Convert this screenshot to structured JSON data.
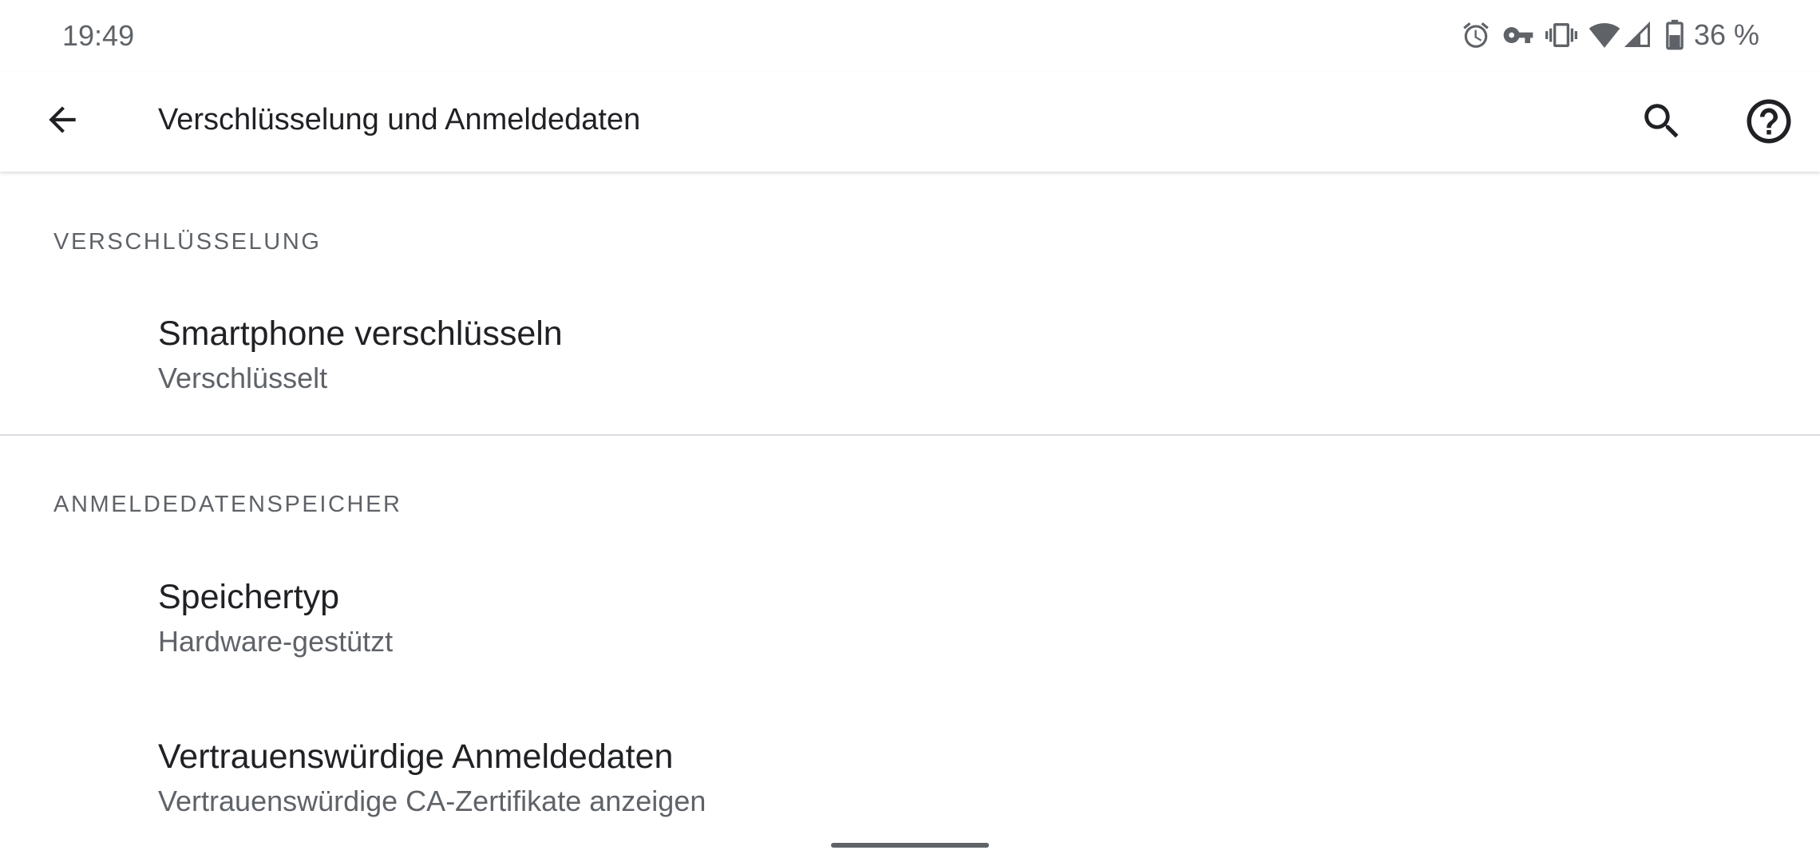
{
  "status_bar": {
    "time": "19:49",
    "icons": [
      "alarm-icon",
      "vpn-key-icon",
      "vibrate-icon",
      "wifi-icon",
      "signal-icon",
      "battery-icon"
    ],
    "battery_percent": "36 %"
  },
  "app_bar": {
    "title": "Verschlüsselung und Anmeldedaten",
    "back_icon": "arrow-back-icon",
    "search_icon": "search-icon",
    "help_icon": "help-icon"
  },
  "sections": [
    {
      "header": "VERSCHLÜSSELUNG",
      "items": [
        {
          "title": "Smartphone verschlüsseln",
          "summary": "Verschlüsselt"
        }
      ]
    },
    {
      "header": "ANMELDEDATENSPEICHER",
      "items": [
        {
          "title": "Speichertyp",
          "summary": "Hardware-gestützt"
        },
        {
          "title": "Vertrauenswürdige Anmeldedaten",
          "summary": "Vertrauenswürdige CA-Zertifikate anzeigen"
        }
      ]
    }
  ],
  "colors": {
    "background": "#ffffff",
    "primary_text": "#202124",
    "secondary_text": "#5f6368",
    "divider": "#dadce0"
  }
}
